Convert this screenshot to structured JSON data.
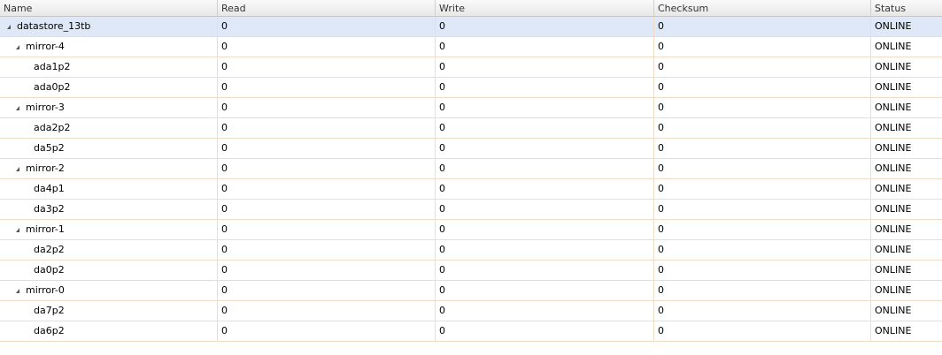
{
  "columns": {
    "name": "Name",
    "read": "Read",
    "write": "Write",
    "checksum": "Checksum",
    "status": "Status"
  },
  "rows": [
    {
      "name": "datastore_13tb",
      "level": 0,
      "expandable": true,
      "read": "0",
      "write": "0",
      "checksum": "0",
      "status": "ONLINE",
      "selected": true
    },
    {
      "name": "mirror-4",
      "level": 1,
      "expandable": true,
      "read": "0",
      "write": "0",
      "checksum": "0",
      "status": "ONLINE"
    },
    {
      "name": "ada1p2",
      "level": 2,
      "expandable": false,
      "read": "0",
      "write": "0",
      "checksum": "0",
      "status": "ONLINE"
    },
    {
      "name": "ada0p2",
      "level": 2,
      "expandable": false,
      "read": "0",
      "write": "0",
      "checksum": "0",
      "status": "ONLINE"
    },
    {
      "name": "mirror-3",
      "level": 1,
      "expandable": true,
      "read": "0",
      "write": "0",
      "checksum": "0",
      "status": "ONLINE"
    },
    {
      "name": "ada2p2",
      "level": 2,
      "expandable": false,
      "read": "0",
      "write": "0",
      "checksum": "0",
      "status": "ONLINE"
    },
    {
      "name": "da5p2",
      "level": 2,
      "expandable": false,
      "read": "0",
      "write": "0",
      "checksum": "0",
      "status": "ONLINE"
    },
    {
      "name": "mirror-2",
      "level": 1,
      "expandable": true,
      "read": "0",
      "write": "0",
      "checksum": "0",
      "status": "ONLINE"
    },
    {
      "name": "da4p1",
      "level": 2,
      "expandable": false,
      "read": "0",
      "write": "0",
      "checksum": "0",
      "status": "ONLINE"
    },
    {
      "name": "da3p2",
      "level": 2,
      "expandable": false,
      "read": "0",
      "write": "0",
      "checksum": "0",
      "status": "ONLINE"
    },
    {
      "name": "mirror-1",
      "level": 1,
      "expandable": true,
      "read": "0",
      "write": "0",
      "checksum": "0",
      "status": "ONLINE"
    },
    {
      "name": "da2p2",
      "level": 2,
      "expandable": false,
      "read": "0",
      "write": "0",
      "checksum": "0",
      "status": "ONLINE"
    },
    {
      "name": "da0p2",
      "level": 2,
      "expandable": false,
      "read": "0",
      "write": "0",
      "checksum": "0",
      "status": "ONLINE"
    },
    {
      "name": "mirror-0",
      "level": 1,
      "expandable": true,
      "read": "0",
      "write": "0",
      "checksum": "0",
      "status": "ONLINE"
    },
    {
      "name": "da7p2",
      "level": 2,
      "expandable": false,
      "read": "0",
      "write": "0",
      "checksum": "0",
      "status": "ONLINE"
    },
    {
      "name": "da6p2",
      "level": 2,
      "expandable": false,
      "read": "0",
      "write": "0",
      "checksum": "0",
      "status": "ONLINE"
    }
  ]
}
